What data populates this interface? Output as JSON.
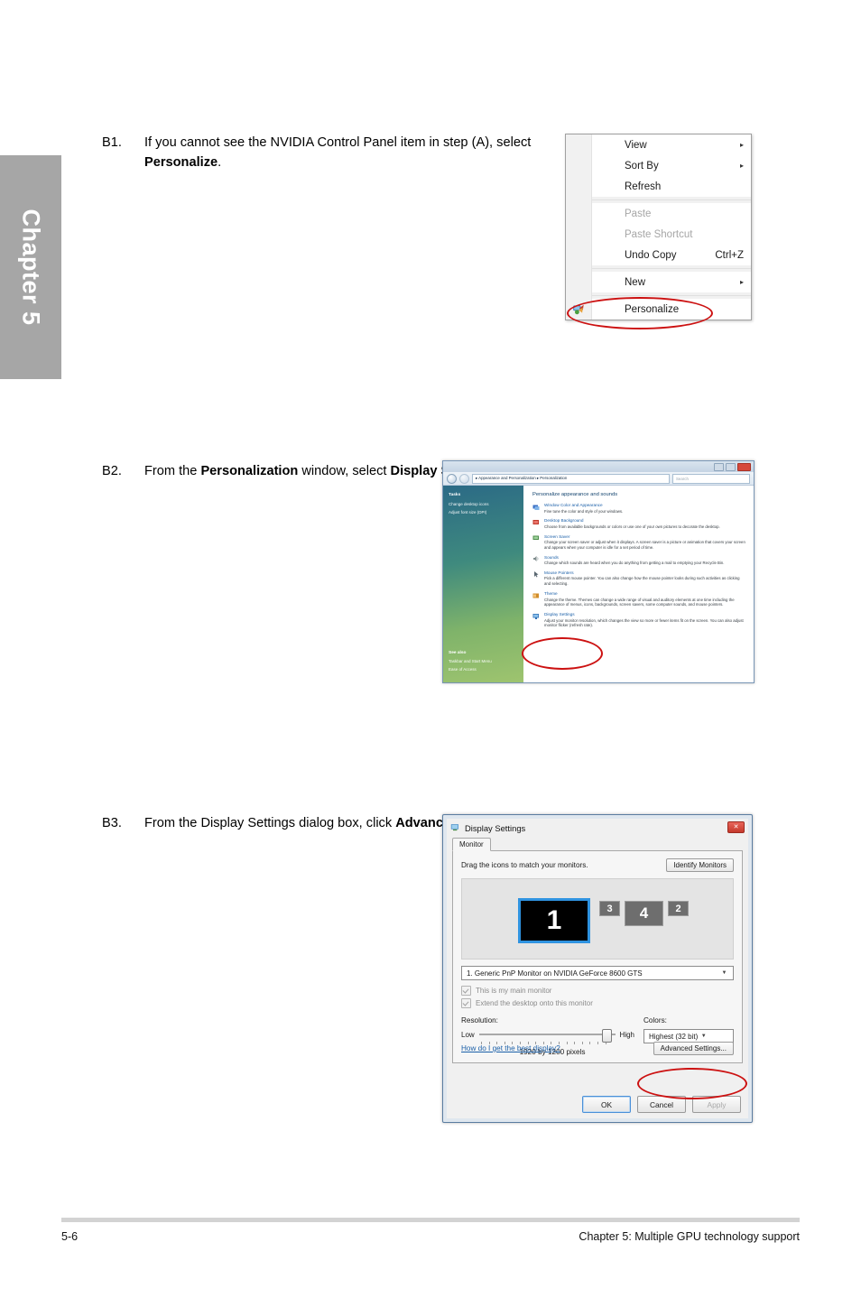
{
  "chapter_tab": {
    "label": "Chapter 5"
  },
  "steps": [
    {
      "label": "B1.",
      "text_before": "If you cannot see the NVIDIA Control Panel item in step (A), select ",
      "bold": "Personalize",
      "text_after": "."
    },
    {
      "label": "B2.",
      "text_before": "From the ",
      "bold": "Personalization",
      "text_mid": " window, select ",
      "bold2": "Display Settings",
      "text_after": "."
    },
    {
      "label": "B3.",
      "text_before": "From the Display Settings dialog box, click ",
      "bold": "Advanced Settings",
      "text_after": "."
    }
  ],
  "context_menu": {
    "items": [
      {
        "label": "View",
        "accel": "",
        "arrow": "▸",
        "disabled": false
      },
      {
        "label": "Sort By",
        "accel": "",
        "arrow": "▸",
        "disabled": false
      },
      {
        "label": "Refresh",
        "accel": "",
        "arrow": "",
        "disabled": false
      },
      {
        "label": "Paste",
        "accel": "",
        "arrow": "",
        "disabled": true
      },
      {
        "label": "Paste Shortcut",
        "accel": "",
        "arrow": "",
        "disabled": true
      },
      {
        "label": "Undo Copy",
        "accel": "Ctrl+Z",
        "arrow": "",
        "disabled": false
      },
      {
        "label": "New",
        "accel": "",
        "arrow": "▸",
        "disabled": false
      },
      {
        "label": "Personalize",
        "accel": "",
        "arrow": "",
        "disabled": false
      }
    ],
    "highlight_color": "#cc1111"
  },
  "personalization_window": {
    "breadcrumb": "▸ Appearance and Personalization ▸ Personalization",
    "search_placeholder": "Search",
    "sidebar": {
      "tasks_heading": "Tasks",
      "tasks": [
        "Change desktop icons",
        "Adjust font size (DPI)"
      ],
      "see_also_heading": "See also",
      "see_also": [
        "Taskbar and Start Menu",
        "Ease of Access"
      ]
    },
    "content_title": "Personalize appearance and sounds",
    "items": [
      {
        "title": "Window Color and Appearance",
        "desc": "Fine tune the color and style of your windows.",
        "icon_color": "#3a6fc4"
      },
      {
        "title": "Desktop Background",
        "desc": "Choose from available backgrounds or colors or use one of your own pictures to decorate the desktop.",
        "icon_color": "#c1392b"
      },
      {
        "title": "Screen Saver",
        "desc": "Change your screen saver or adjust when it displays. A screen saver is a picture or animation that covers your screen and appears when your computer is idle for a set period of time.",
        "icon_color": "#4c8c4a"
      },
      {
        "title": "Sounds",
        "desc": "Change which sounds are heard when you do anything from getting a mail to emptying your Recycle Bin.",
        "icon_color": "#7f8c8d"
      },
      {
        "title": "Mouse Pointers",
        "desc": "Pick a different mouse pointer. You can also change how the mouse pointer looks during such activities as clicking and selecting.",
        "icon_color": "#596670"
      },
      {
        "title": "Theme",
        "desc": "Change the theme. Themes can change a wide range of visual and auditory elements at one time including the appearance of menus, icons, backgrounds, screen savers, some computer sounds, and mouse pointers.",
        "icon_color": "#d08c2a"
      },
      {
        "title": "Display Settings",
        "desc": "Adjust your monitor resolution, which changes the view so more or fewer items fit on the screen. You can also adjust monitor flicker (refresh rate).",
        "icon_color": "#2d6fb5"
      }
    ]
  },
  "display_settings": {
    "title": "Display Settings",
    "close_label": "✕",
    "tab": "Monitor",
    "drag_text": "Drag the icons to match your monitors.",
    "identify_button": "Identify Monitors",
    "monitors": [
      {
        "number": "1",
        "selected": true
      },
      {
        "number": "3",
        "selected": false
      },
      {
        "number": "4",
        "selected": false
      },
      {
        "number": "2",
        "selected": false
      }
    ],
    "monitor_select": "1. Generic PnP Monitor on NVIDIA GeForce 8600 GTS",
    "checkboxes": [
      {
        "label": "This is my main monitor",
        "checked": true
      },
      {
        "label": "Extend the desktop onto this monitor",
        "checked": true
      }
    ],
    "resolution_label": "Resolution:",
    "slider_low": "Low",
    "slider_high": "High",
    "resolution_value": "1920 by 1200 pixels",
    "colors_label": "Colors:",
    "colors_value": "Highest (32 bit)",
    "help_link": "How do I get the best display?",
    "advanced_button": "Advanced Settings...",
    "buttons": [
      {
        "label": "OK",
        "state": "default"
      },
      {
        "label": "Cancel",
        "state": "normal"
      },
      {
        "label": "Apply",
        "state": "disabled"
      }
    ]
  },
  "footer": {
    "page_number": "5-6",
    "chapter_title": "Chapter 5: Multiple GPU technology support"
  }
}
